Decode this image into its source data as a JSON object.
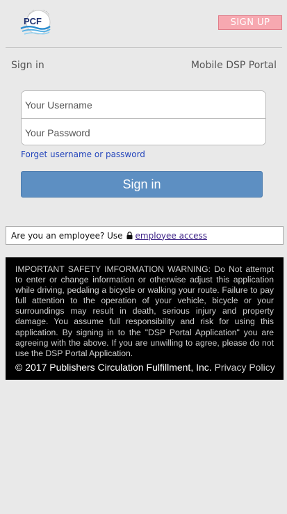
{
  "header": {
    "logo_text": "PCF",
    "signup_label": "SIGN UP"
  },
  "title_bar": {
    "sign_in_label": "Sign in",
    "portal_label": "Mobile DSP Portal"
  },
  "login_form": {
    "username_placeholder": "Your Username",
    "username_value": "",
    "password_placeholder": "Your Password",
    "password_value": "",
    "forget_link": "Forget username or password",
    "signin_label": "Sign in"
  },
  "employee": {
    "prompt": "Are you an employee? Use",
    "link": "employee access"
  },
  "safety": {
    "text": "IMPORTANT SAFETY IMFORMATION WARNING: Do Not attempt to enter or change information or otherwise adjust this application while driving, pedaling a bicycle or walking your route. Failure to pay full attention to the operation of your vehicle, bicycle or your surroundings may result in death, serious injury and property damage. You assume full responsibility and risk for using this application. By signing in to the \"DSP Portal Application\" you are agreeing with the above. If you are unwilling to agree, please do not use the DSP Portal Application.",
    "copyright": "© 2017 Publishers Circulation Fulfillment, Inc.",
    "privacy_link": "Privacy Policy"
  },
  "colors": {
    "signup_bg": "#f7a8b0",
    "signin_btn": "#5d8fc2",
    "link": "#2244bb",
    "panel_bg": "#000000"
  },
  "icons": {
    "logo": "pcf-logo",
    "lock": "lock-icon"
  }
}
